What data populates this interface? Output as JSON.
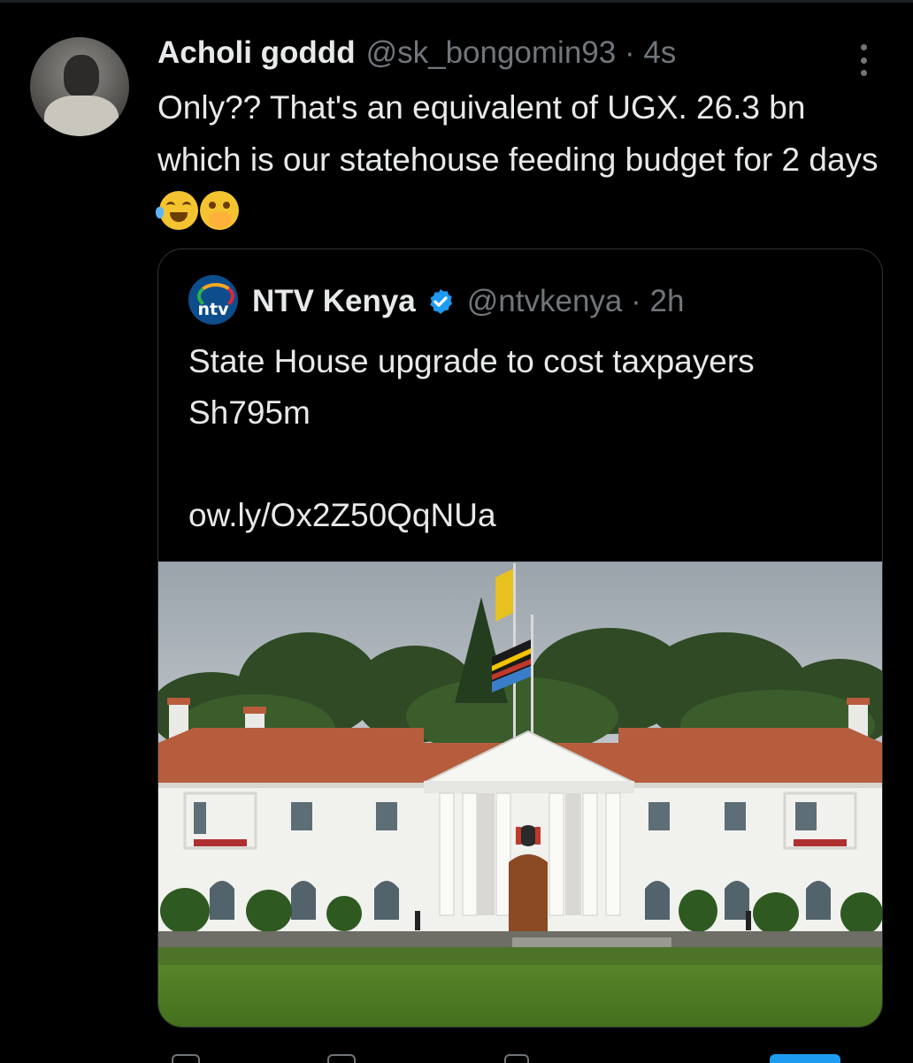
{
  "tweet": {
    "display_name": "Acholi goddd",
    "meta": "@sk_bongomin93 · 4s",
    "text": "Only?? That's an equivalent of UGX. 26.3 bn which is our statehouse feeding budget for 2 days",
    "avatar_icon": "profile-photo",
    "more_icon": "more-vertical-icon",
    "emojis": [
      "face-with-tears-of-joy-emoji",
      "face-with-hand-over-mouth-emoji"
    ]
  },
  "quoted": {
    "display_name": "NTV Kenya",
    "logo_text": "ntv",
    "verified_icon": "verified-badge-icon",
    "meta": "@ntvkenya · 2h",
    "text": "State House upgrade to cost taxpayers Sh795m",
    "link": "ow.ly/Ox2Z50QqNUa",
    "image_alt": "state-house-photo"
  },
  "colors": {
    "background": "#000000",
    "primary_text": "#e7e9ea",
    "secondary_text": "#71767b",
    "border": "#2f3336",
    "accent": "#1d9bf0"
  }
}
